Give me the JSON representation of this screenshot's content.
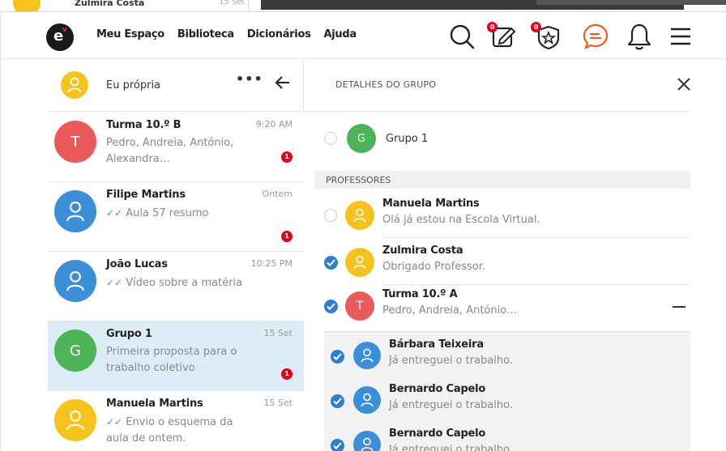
{
  "background_window": {
    "name": "Zulmira Costa",
    "date": "15 Set"
  },
  "header": {
    "nav": [
      "Meu Espaço",
      "Biblioteca",
      "Dicionários",
      "Ajuda"
    ],
    "icons": [
      "search-icon",
      "edit-icon",
      "badge-shield-icon",
      "chat-icon",
      "bell-icon",
      "menu-icon"
    ],
    "edit_badge": "0",
    "shield_badge": "0"
  },
  "me": {
    "label": "Eu própria",
    "more": "•••"
  },
  "conversations": [
    {
      "initial": "T",
      "name": "Turma 10.º B",
      "message": "Pedro, Andreia, António, Alexandra…",
      "time": "9:20 AM",
      "badge": "1",
      "color": "red",
      "ticks": false,
      "active": false
    },
    {
      "initial": "user",
      "name": "Filipe Martins",
      "message": "Aula 57 resumo",
      "time": "Ontem",
      "badge": "1",
      "color": "blue",
      "ticks": true,
      "active": false
    },
    {
      "initial": "user",
      "name": "João Lucas",
      "message": "Vídeo sobre a matéria",
      "time": "10:25 PM",
      "badge": "",
      "color": "blue",
      "ticks": true,
      "active": false
    },
    {
      "initial": "G",
      "name": "Grupo 1",
      "message": "Primeira proposta para o trabalho coletivo",
      "time": "15 Set",
      "badge": "1",
      "color": "green",
      "ticks": false,
      "active": true
    },
    {
      "initial": "user",
      "name": "Manuela Martins",
      "message": "Envio o esquema da aula de ontem.",
      "time": "15 Set",
      "badge": "",
      "color": "yellow",
      "ticks": true,
      "active": false
    }
  ],
  "details": {
    "title": "DETALHES DO GRUPO",
    "group": {
      "initial": "G",
      "name": "Grupo 1"
    },
    "section": "PROFESSORES",
    "professors": [
      {
        "name": "Manuela Martins",
        "message": "Olá já estou na Escola Virtual.",
        "checked": false,
        "color": "yellow",
        "initial": "user"
      },
      {
        "name": "Zulmira Costa",
        "message": "Obrigado Professor.",
        "checked": true,
        "color": "yellow",
        "initial": "user"
      },
      {
        "name": "Turma 10.º A",
        "message": "Pedro, Andreia, António…",
        "checked": true,
        "color": "red",
        "initial": "T"
      }
    ],
    "students": [
      {
        "name": "Bárbara Teixeira",
        "message": "Já entreguei o trabalho.",
        "checked": true
      },
      {
        "name": "Bernardo Capelo",
        "message": "Já entreguei o trabalho.",
        "checked": true
      },
      {
        "name": "Bernardo Capelo",
        "message": "Já entreguei o trabalho.",
        "checked": true
      }
    ]
  },
  "colors": {
    "red": "#e95b5b",
    "blue": "#3b8fd9",
    "green": "#4db357",
    "yellow": "#f6c21c",
    "badge": "#e3001b",
    "active_row": "#dcedf8"
  }
}
